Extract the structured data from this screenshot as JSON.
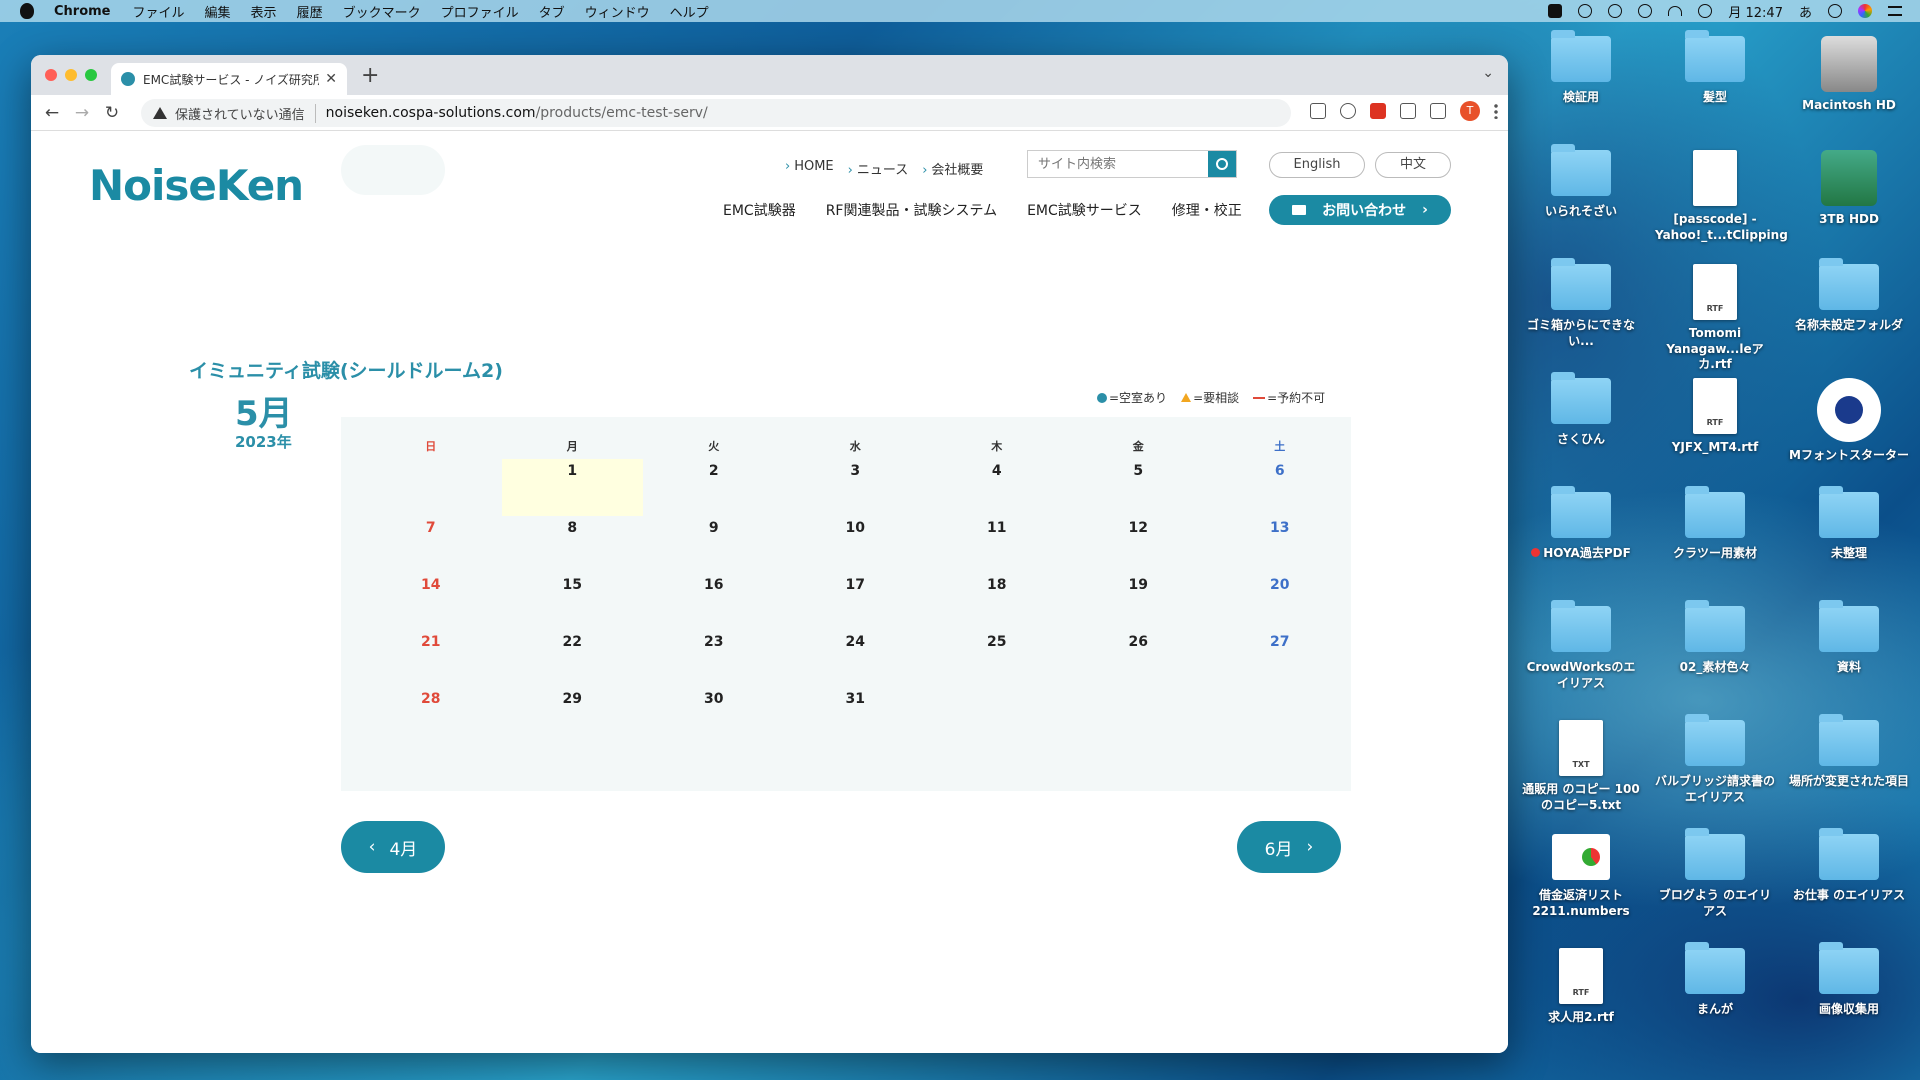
{
  "menubar": {
    "app": "Chrome",
    "items": [
      "ファイル",
      "編集",
      "表示",
      "履歴",
      "ブックマーク",
      "プロファイル",
      "タブ",
      "ウィンドウ",
      "ヘルプ"
    ],
    "clock": "月 12:47",
    "ime": "あ"
  },
  "browser": {
    "tab_title": "EMC試験サービス - ノイズ研究所",
    "insecure_label": "保護されていない通信",
    "url_host": "noiseken.cospa-solutions.com",
    "url_path": "/products/emc-test-serv/",
    "avatar_letter": "T"
  },
  "site": {
    "logo": "NoiseKen",
    "toplinks": [
      "HOME",
      "ニュース",
      "会社概要"
    ],
    "search_placeholder": "サイト内検索",
    "lang_en": "English",
    "lang_zh": "中文",
    "nav": [
      "EMC試験器",
      "RF関連製品・試験システム",
      "EMC試験サービス",
      "修理・校正"
    ],
    "contact": "お問い合わせ"
  },
  "calendar": {
    "title": "イミュニティ試験(シールドルーム2)",
    "month": "5月",
    "year": "2023年",
    "legend": {
      "available": "=空室あり",
      "consult": "=要相談",
      "unavailable": "=予約不可"
    },
    "weekdays": [
      "日",
      "月",
      "火",
      "水",
      "木",
      "金",
      "土"
    ],
    "weeks": [
      [
        "",
        "1",
        "2",
        "3",
        "4",
        "5",
        "6"
      ],
      [
        "7",
        "8",
        "9",
        "10",
        "11",
        "12",
        "13"
      ],
      [
        "14",
        "15",
        "16",
        "17",
        "18",
        "19",
        "20"
      ],
      [
        "21",
        "22",
        "23",
        "24",
        "25",
        "26",
        "27"
      ],
      [
        "28",
        "29",
        "30",
        "31",
        "",
        "",
        ""
      ]
    ],
    "highlighted_day": "1",
    "prev_label": "4月",
    "next_label": "6月",
    "colors": {
      "accent": "#1b8aa3",
      "sunday": "#e04a3a",
      "saturday": "#3d70c8",
      "today": "#ffffe0"
    }
  },
  "desktop": [
    {
      "label": "検証用",
      "kind": "folder"
    },
    {
      "label": "髪型",
      "kind": "folder"
    },
    {
      "label": "Macintosh HD",
      "kind": "disk"
    },
    {
      "label": "いられそざい",
      "kind": "folder"
    },
    {
      "label": "[passcode] - Yahoo!_t...tClipping",
      "kind": "doc"
    },
    {
      "label": "3TB HDD",
      "kind": "disk-tm"
    },
    {
      "label": "ゴミ箱からにできない...",
      "kind": "folder"
    },
    {
      "label": "Tomomi Yanagaw...leアカ.rtf",
      "kind": "rtf"
    },
    {
      "label": "名称未設定フォルダ",
      "kind": "folder"
    },
    {
      "label": "さくひん",
      "kind": "folder"
    },
    {
      "label": "YJFX_MT4.rtf",
      "kind": "rtf"
    },
    {
      "label": "Mフォントスターター",
      "kind": "app"
    },
    {
      "label": "HOYA過去PDF",
      "kind": "folder-tag"
    },
    {
      "label": "クラツー用素材",
      "kind": "folder"
    },
    {
      "label": "未整理",
      "kind": "folder"
    },
    {
      "label": "CrowdWorksのエイリアス",
      "kind": "folder"
    },
    {
      "label": "02_素材色々",
      "kind": "folder"
    },
    {
      "label": "資料",
      "kind": "folder"
    },
    {
      "label": "通販用 のコピー 100のコピー5.txt",
      "kind": "txt"
    },
    {
      "label": "バルブリッジ請求書のエイリアス",
      "kind": "folder"
    },
    {
      "label": "場所が変更された項目",
      "kind": "folder"
    },
    {
      "label": "借金返済リスト2211.numbers",
      "kind": "sheet"
    },
    {
      "label": "ブログよう のエイリアス",
      "kind": "folder"
    },
    {
      "label": "お仕事 のエイリアス",
      "kind": "folder"
    },
    {
      "label": "求人用2.rtf",
      "kind": "rtf"
    },
    {
      "label": "まんが",
      "kind": "folder"
    },
    {
      "label": "画像収集用",
      "kind": "folder"
    }
  ],
  "doc_badges": {
    "rtf": "RTF",
    "txt": "TXT"
  }
}
